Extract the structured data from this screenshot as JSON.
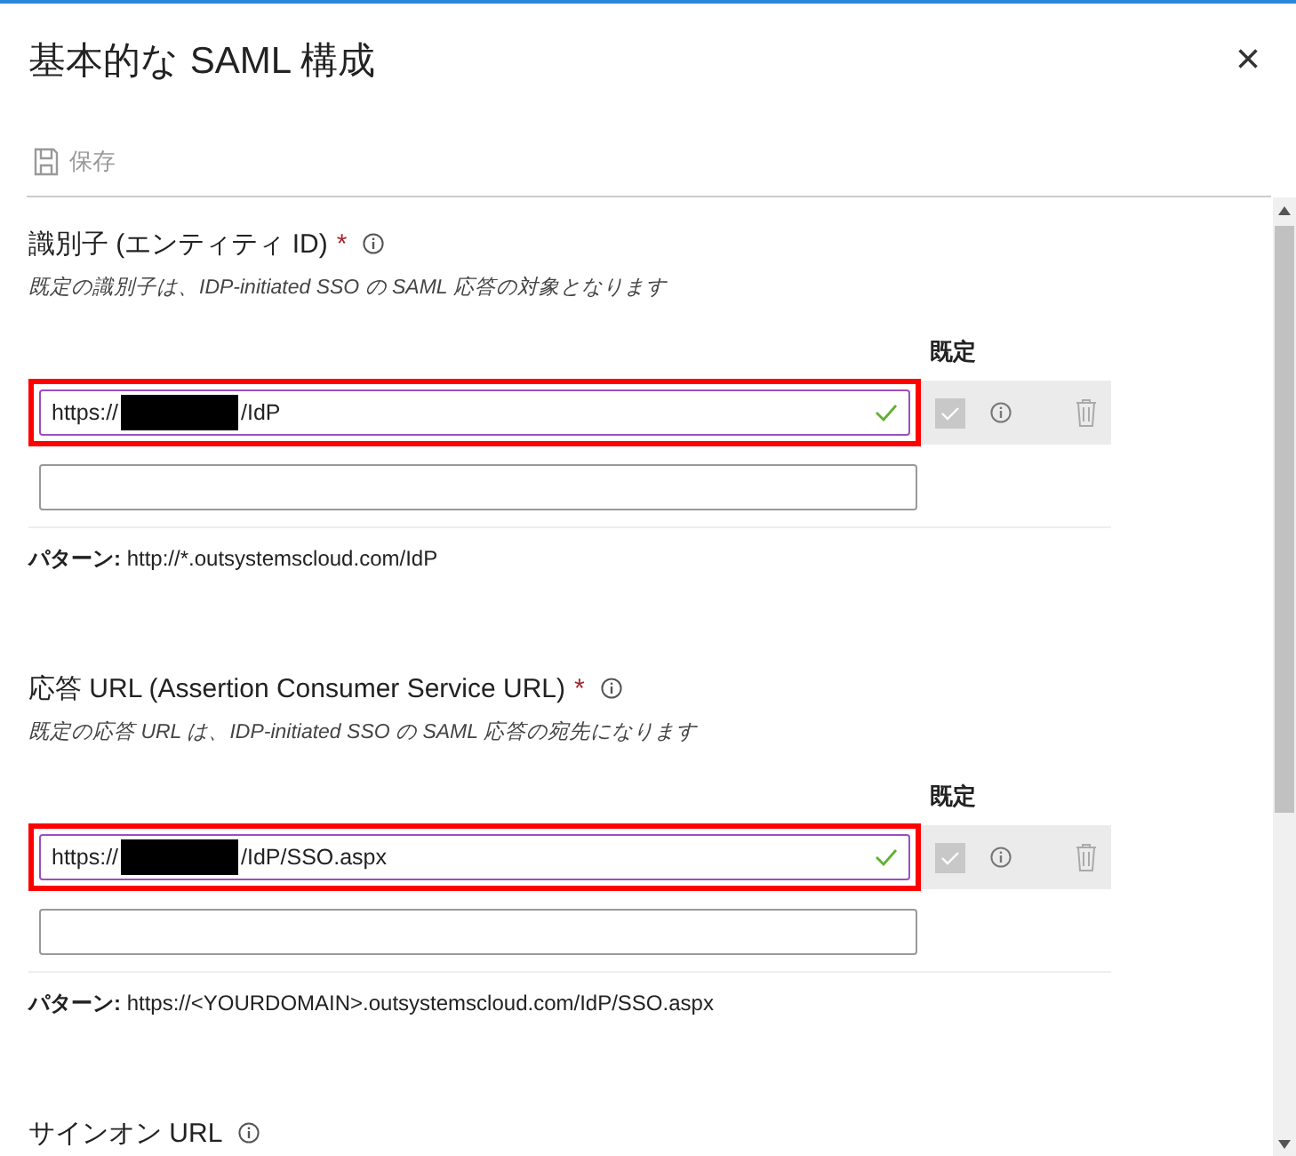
{
  "window": {
    "title": "基本的な SAML 構成",
    "close": "×"
  },
  "toolbar": {
    "save_label": "保存",
    "disabled": true
  },
  "sections": [
    {
      "label": "識別子 (エンティティ ID)",
      "required_mark": "*",
      "hint": "既定の識別子は、IDP-initiated SSO の SAML 応答の対象となります",
      "default_header": "既定",
      "entries": [
        {
          "value_prefix": "https://",
          "redacted": true,
          "value_suffix": "/IdP",
          "valid": true,
          "highlighted": true,
          "default_checked": true
        }
      ],
      "pattern_label": "パターン:",
      "pattern": "http://*.outsystemscloud.com/IdP"
    },
    {
      "label": "応答 URL (Assertion Consumer Service URL)",
      "required_mark": "*",
      "hint": "既定の応答 URL は、IDP-initiated SSO の SAML 応答の宛先になります",
      "default_header": "既定",
      "entries": [
        {
          "value_prefix": "https://",
          "redacted": true,
          "value_suffix": "/IdP/SSO.aspx",
          "valid": true,
          "highlighted": true,
          "default_checked": true
        }
      ],
      "pattern_label": "パターン:",
      "pattern": "https://<YOURDOMAIN>.outsystemscloud.com/IdP/SSO.aspx"
    },
    {
      "label": "サインオン URL"
    }
  ]
}
